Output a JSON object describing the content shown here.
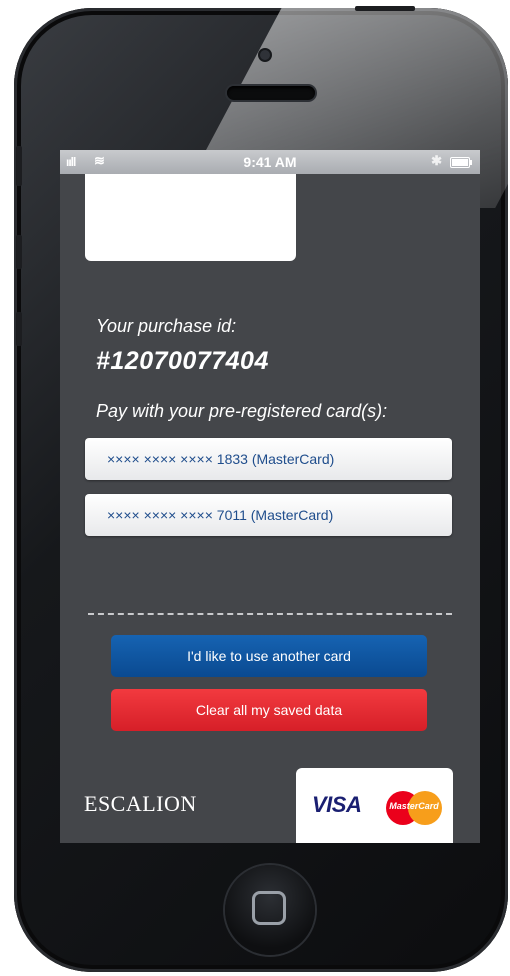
{
  "statusbar": {
    "signal": "ııll",
    "wifi": "≋",
    "time": "9:41 AM",
    "bluetooth": "✱"
  },
  "purchase": {
    "label": "Your purchase id:",
    "id": "#12070077404"
  },
  "cards": {
    "label": "Pay with your pre-registered card(s):",
    "items": [
      {
        "text": "×××× ×××× ×××× 1833 (MasterCard)"
      },
      {
        "text": "×××× ×××× ×××× 7011 (MasterCard)"
      }
    ]
  },
  "actions": {
    "another_card": "I'd like to use another card",
    "clear_data": "Clear all my saved data"
  },
  "footer": {
    "brand": "ESCALION",
    "visa": "VISA",
    "mastercard": "MasterCard"
  },
  "colors": {
    "blue_button": "#0d56a6",
    "red_button": "#e62a30",
    "card_text": "#1f4d8c",
    "screen_bg": "#44464a"
  }
}
